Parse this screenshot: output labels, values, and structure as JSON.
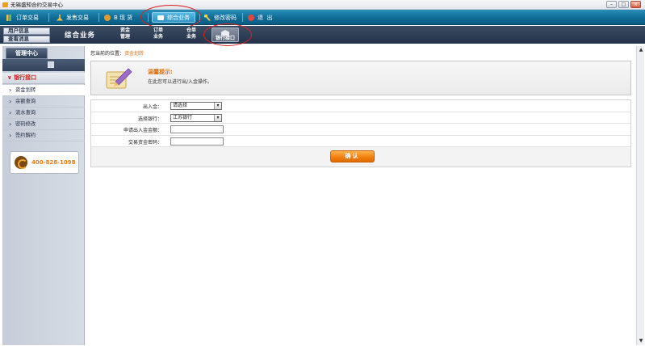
{
  "window": {
    "title": "无锡盛知合约交易中心",
    "min": "–",
    "max": "□",
    "close": "×"
  },
  "menu": {
    "items": [
      {
        "label": "订单交易",
        "icon": "bar-chart-icon",
        "color": "#f5c242"
      },
      {
        "label": "发售交易",
        "icon": "tool-icon",
        "color": "#f5c242"
      },
      {
        "label": "B 现 货",
        "icon": "coin-icon",
        "color": "#e39a2b"
      },
      {
        "label": "综合业务",
        "icon": "card-icon",
        "color": "#ffffff"
      },
      {
        "label": "修改密码",
        "icon": "key-icon",
        "color": "#f7d04a"
      },
      {
        "label": "退  出",
        "icon": "power-icon",
        "color": "#e2463d"
      }
    ]
  },
  "subbar": {
    "left_tabs": [
      "用户信息",
      "查看消息"
    ],
    "title": "综合业务",
    "buttons": [
      {
        "line1": "资金",
        "line2": "管理"
      },
      {
        "line1": "订单",
        "line2": "业务"
      },
      {
        "line1": "仓单",
        "line2": "业务"
      },
      {
        "line1": "",
        "line2": "银行接口"
      }
    ]
  },
  "sidebar": {
    "header": "管理中心",
    "group": "银行接口",
    "items": [
      "资金划转",
      "余额查询",
      "流水查询",
      "密码修改",
      "签约解约"
    ],
    "hotline": "400-828-1098"
  },
  "main": {
    "breadcrumb_prefix": "您当前的位置：",
    "breadcrumb_current": "资金划转",
    "notice_title": "温馨提示:",
    "notice_text": "在此您可以进行出/入金操作。",
    "form": {
      "rows": [
        {
          "label": "出入金：",
          "type": "select",
          "value": "请选择"
        },
        {
          "label": "选择银行：",
          "type": "select",
          "value": "江苏银行"
        },
        {
          "label": "申请出入金金额：",
          "type": "text",
          "value": ""
        },
        {
          "label": "交易资金密码：",
          "type": "text",
          "value": ""
        }
      ],
      "confirm": "确认"
    }
  },
  "scroll": {
    "up": "▲",
    "down": "▼"
  }
}
